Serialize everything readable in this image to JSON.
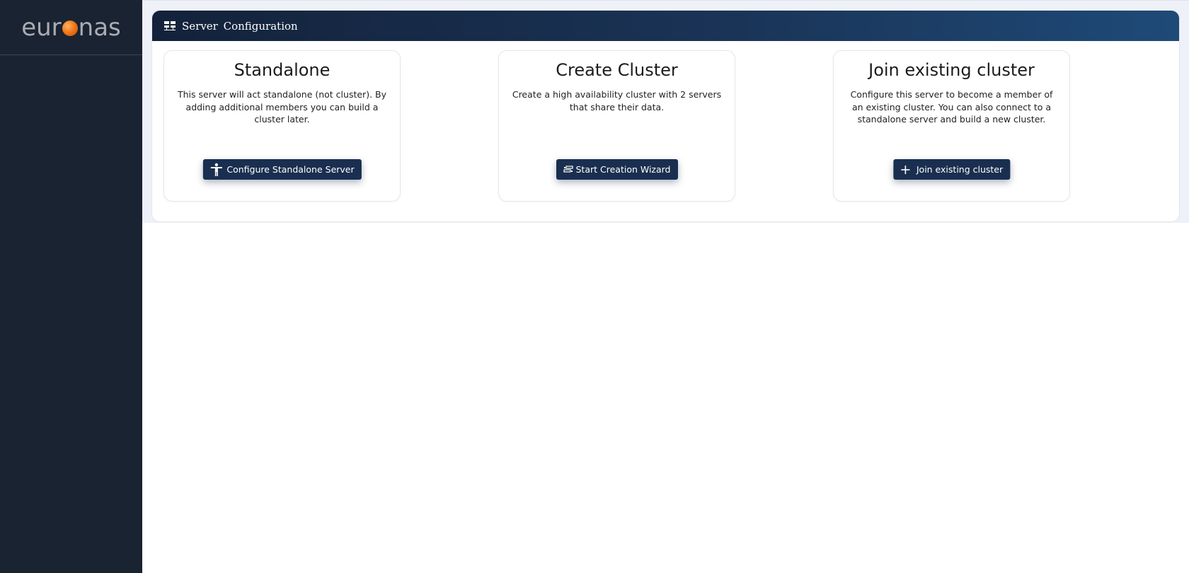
{
  "brand": {
    "logo_left": "eur",
    "logo_right": "nas",
    "accent_color": "#f07a1a"
  },
  "header": {
    "icon": "server-config-icon",
    "title": "Server Configuration"
  },
  "cards": [
    {
      "title": "Standalone",
      "description": "This server will act standalone (not cluster). By adding additional members you can build a cluster later.",
      "button_label": "Configure Standalone Server",
      "button_icon": "person-icon"
    },
    {
      "title": "Create Cluster",
      "description": "Create a high availability cluster with 2 servers that share their data.",
      "button_label": "Start Creation Wizard",
      "button_icon": "cluster-icon"
    },
    {
      "title": "Join existing cluster",
      "description": "Configure this server to become a member of an existing cluster. You can also connect to a standalone server and build a new cluster.",
      "button_label": "Join existing cluster",
      "button_icon": "plus-icon"
    }
  ],
  "colors": {
    "sidebar": "#1a2332",
    "button": "#1a2f50",
    "header_start": "#13223a",
    "header_end": "#1e4a78"
  }
}
